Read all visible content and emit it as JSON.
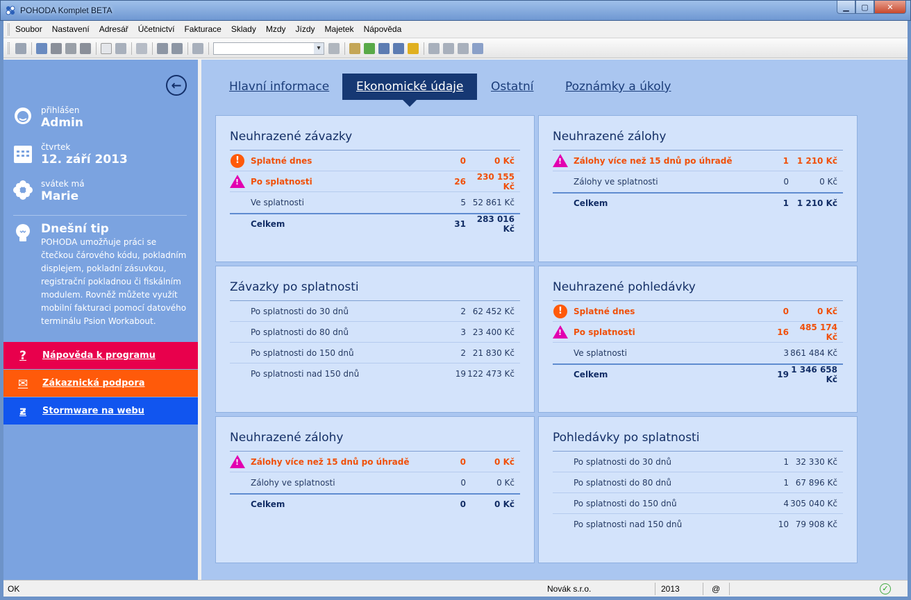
{
  "window": {
    "title": "POHODA Komplet BETA"
  },
  "menu": [
    "Soubor",
    "Nastavení",
    "Adresář",
    "Účetnictví",
    "Fakturace",
    "Sklady",
    "Mzdy",
    "Jízdy",
    "Majetek",
    "Nápověda"
  ],
  "sidebar": {
    "user_label": "přihlášen",
    "user_name": "Admin",
    "day_label": "čtvrtek",
    "date": "12. září 2013",
    "nameday_label": "svátek má",
    "nameday_name": "Marie",
    "tip_title": "Dnešní tip",
    "tip_text": "POHODA umožňuje práci se čtečkou čárového kódu, pokladním displejem, pokladní zásuvkou, registrační pokladnou či fiskálním modulem. Rovněž můžete využít mobilní fakturaci pomocí datového terminálu Psion Workabout.",
    "links": {
      "help": "Nápověda k programu",
      "support": "Zákaznická podpora",
      "web": "Stormware na webu"
    }
  },
  "tabs": {
    "main": "Hlavní informace",
    "econ": "Ekonomické údaje",
    "other": "Ostatní",
    "notes": "Poznámky a úkoly"
  },
  "cards": {
    "zavazky": {
      "title": "Neuhrazené závazky",
      "rows": [
        {
          "label": "Splatné dnes",
          "count": "0",
          "amount": "0 Kč"
        },
        {
          "label": "Po splatnosti",
          "count": "26",
          "amount": "230 155 Kč"
        },
        {
          "label": "Ve splatnosti",
          "count": "5",
          "amount": "52 861 Kč"
        },
        {
          "label": "Celkem",
          "count": "31",
          "amount": "283 016 Kč"
        }
      ]
    },
    "zalohy_right": {
      "title": "Neuhrazené zálohy",
      "rows": [
        {
          "label": "Zálohy více než 15 dnů po úhradě",
          "count": "1",
          "amount": "1 210 Kč"
        },
        {
          "label": "Zálohy ve splatnosti",
          "count": "0",
          "amount": "0 Kč"
        },
        {
          "label": "Celkem",
          "count": "1",
          "amount": "1 210 Kč"
        }
      ]
    },
    "zavazky_po": {
      "title": "Závazky po splatnosti",
      "rows": [
        {
          "label": "Po splatnosti do 30 dnů",
          "count": "2",
          "amount": "62 452 Kč"
        },
        {
          "label": "Po splatnosti do 80 dnů",
          "count": "3",
          "amount": "23 400 Kč"
        },
        {
          "label": "Po splatnosti do 150 dnů",
          "count": "2",
          "amount": "21 830 Kč"
        },
        {
          "label": "Po splatnosti nad 150 dnů",
          "count": "19",
          "amount": "122 473 Kč"
        }
      ]
    },
    "pohledavky": {
      "title": "Neuhrazené pohledávky",
      "rows": [
        {
          "label": "Splatné dnes",
          "count": "0",
          "amount": "0 Kč"
        },
        {
          "label": "Po splatnosti",
          "count": "16",
          "amount": "485 174 Kč"
        },
        {
          "label": "Ve splatnosti",
          "count": "3",
          "amount": "861 484 Kč"
        },
        {
          "label": "Celkem",
          "count": "19",
          "amount": "1 346 658 Kč"
        }
      ]
    },
    "zalohy_left": {
      "title": "Neuhrazené zálohy",
      "rows": [
        {
          "label": "Zálohy více než 15 dnů po úhradě",
          "count": "0",
          "amount": "0 Kč"
        },
        {
          "label": "Zálohy ve splatnosti",
          "count": "0",
          "amount": "0 Kč"
        },
        {
          "label": "Celkem",
          "count": "0",
          "amount": "0 Kč"
        }
      ]
    },
    "pohledavky_po": {
      "title": "Pohledávky po splatnosti",
      "rows": [
        {
          "label": "Po splatnosti do 30 dnů",
          "count": "1",
          "amount": "32 330 Kč"
        },
        {
          "label": "Po splatnosti do 80 dnů",
          "count": "1",
          "amount": "67 896 Kč"
        },
        {
          "label": "Po splatnosti do 150 dnů",
          "count": "4",
          "amount": "305 040 Kč"
        },
        {
          "label": "Po splatnosti nad 150 dnů",
          "count": "10",
          "amount": "79 908 Kč"
        }
      ]
    }
  },
  "status": {
    "state": "OK",
    "company": "Novák s.r.o.",
    "year": "2013",
    "at": "@"
  },
  "colors": {
    "accent": "#163873",
    "warning": "#ff5a0a",
    "alert": "#e200b0",
    "help": "#e8004c",
    "support": "#ff5a0a",
    "web": "#1155ef"
  }
}
